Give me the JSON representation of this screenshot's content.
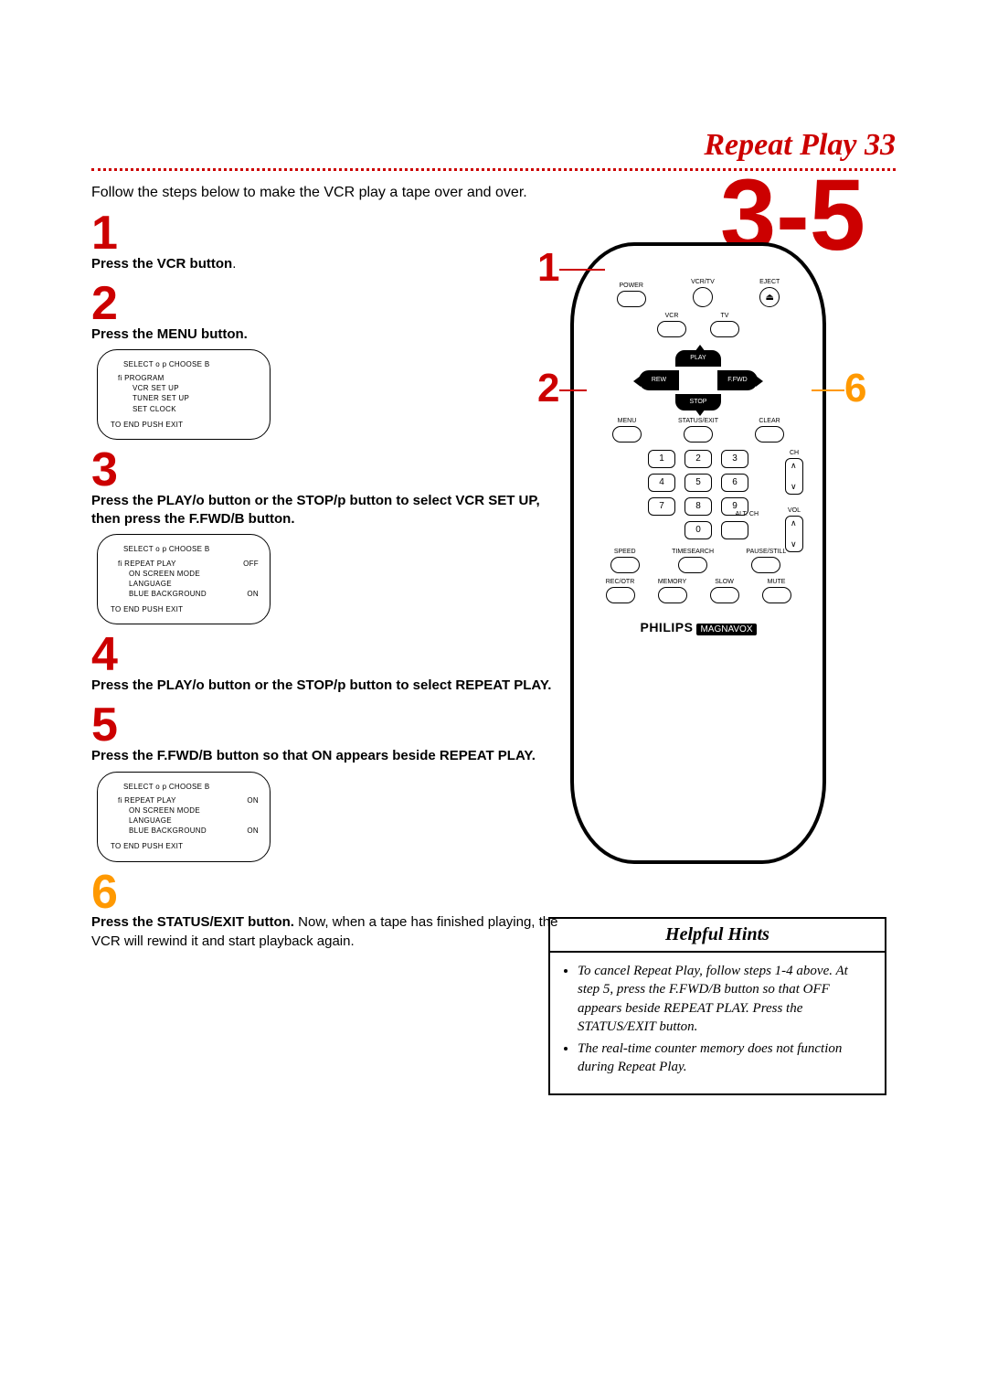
{
  "header": "Repeat Play  33",
  "intro": "Follow the steps below to make the VCR play a tape over and over.",
  "steps": {
    "s1": {
      "num": "1",
      "text_a": "Press the VCR button",
      "text_b": "."
    },
    "s2": {
      "num": "2",
      "text_a": "Press the MENU button."
    },
    "s3": {
      "num": "3",
      "text_a": "Press the PLAY/o  button or the STOP/p  button to select VCR SET UP, then press the F.FWD/B  button."
    },
    "s4": {
      "num": "4",
      "text_a": "Press the PLAY/o  button or the STOP/p  button to select REPEAT PLAY."
    },
    "s5": {
      "num": "5",
      "text_a": "Press the F.FWD/B  button so that ON appears beside REPEAT PLAY."
    },
    "s6": {
      "num": "6",
      "text_a": "Press the STATUS/EXIT button. ",
      "text_b": "Now, when a tape has finished playing, the VCR will rewind it and start playback again."
    }
  },
  "osd1": {
    "hdr": "SELECT o p CHOOSE B",
    "items": [
      "fi  PROGRAM",
      "VCR SET UP",
      "TUNER SET UP",
      "SET CLOCK"
    ],
    "ft": "TO END PUSH EXIT"
  },
  "osd2": {
    "hdr": "SELECT o p CHOOSE B",
    "r1l": "fi  REPEAT PLAY",
    "r1r": "OFF",
    "r2l": "ON SCREEN MODE",
    "r2r": "",
    "r3l": "LANGUAGE",
    "r3r": "",
    "r4l": "BLUE BACKGROUND",
    "r4r": "ON",
    "ft": "TO END PUSH EXIT"
  },
  "osd3": {
    "hdr": "SELECT o p CHOOSE B",
    "r1l": "fi  REPEAT PLAY",
    "r1r": "ON",
    "r2l": "ON SCREEN MODE",
    "r2r": "",
    "r3l": "LANGUAGE",
    "r3r": "",
    "r4l": "BLUE BACKGROUND",
    "r4r": "ON",
    "ft": "TO END PUSH EXIT"
  },
  "remote": {
    "power": "POWER",
    "vcrtv": "VCR/TV",
    "eject": "EJECT",
    "vcr": "VCR",
    "tv": "TV",
    "play": "PLAY",
    "stop": "STOP",
    "rew": "REW",
    "ffwd": "F.FWD",
    "menu": "MENU",
    "status": "STATUS/EXIT",
    "clear": "CLEAR",
    "ch": "CH",
    "altch": "ALT. CH",
    "vol": "VOL",
    "speed": "SPEED",
    "ts": "TIMESEARCH",
    "pause": "PAUSE/STILL",
    "recotr": "REC/OTR",
    "memory": "MEMORY",
    "slow": "SLOW",
    "mute": "MUTE",
    "brand1": "PHILIPS",
    "brand2": "MAGNAVOX",
    "d1": "1",
    "d2": "2",
    "d3": "3",
    "d4": "4",
    "d5": "5",
    "d6": "6",
    "d7": "7",
    "d8": "8",
    "d9": "9",
    "d0": "0"
  },
  "callouts": {
    "c1": "1",
    "c2": "2",
    "big35": "3-5",
    "c6": "6"
  },
  "hints": {
    "title": "Helpful Hints",
    "h1": "To cancel Repeat Play, follow steps 1-4 above. At step 5, press the F.FWD/B  button so that OFF appears beside REPEAT PLAY. Press the STATUS/EXIT button.",
    "h2": "The real-time counter memory does not function during Repeat Play."
  }
}
